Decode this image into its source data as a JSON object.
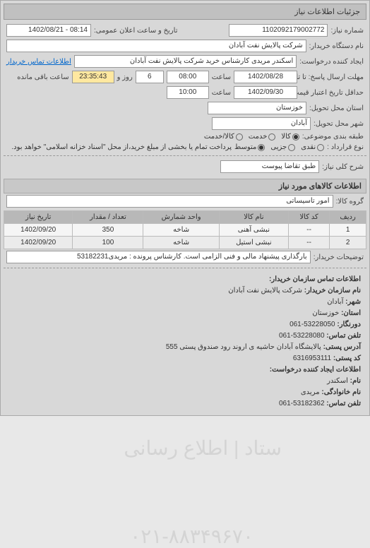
{
  "header": {
    "title": "جزئیات اطلاعات نیاز"
  },
  "fields": {
    "req_number_label": "شماره نیاز:",
    "req_number": "1102092179002772",
    "announce_label": "تاریخ و ساعت اعلان عمومی:",
    "announce": "08:14 - 1402/08/21",
    "buyer_org_label": "نام دستگاه خریدار:",
    "buyer_org": "شرکت پالایش نفت آبادان",
    "requester_label": "ایجاد کننده درخواست:",
    "requester": "اسکندر مریدی کارشناس خرید شرکت پالایش نفت آبادان",
    "buyer_contact_link": "اطلاعات تماس خریدار",
    "deadline_label": "مهلت ارسال پاسخ: تا تاریخ:",
    "deadline_date": "1402/08/28",
    "time_label": "ساعت",
    "deadline_time": "08:00",
    "remain_and": "و",
    "remain_days": "6",
    "remain_days_label": "روز و",
    "remain_time": "23:35:43",
    "remain_label": "ساعت باقی مانده",
    "validity_label": "حداقل تاریخ اعتبار قیمت: تا تاریخ:",
    "validity_date": "1402/09/30",
    "validity_time": "10:00",
    "province_label": "استان محل تحویل:",
    "province": "خوزستان",
    "city_label": "شهر محل تحویل:",
    "city": "آبادان",
    "subject_class_label": "طبقه بندی موضوعی:",
    "subject_kala": "کالا",
    "subject_service": "خدمت",
    "subject_both": "کالا/خدمت",
    "pay_type_label": "نوع قرارداد :",
    "pay_cash": "نقدی",
    "pay_partial": "جزیی",
    "pay_medium": "متوسط",
    "pay_note": "پرداخت تمام یا بخشی از مبلغ خرید،از محل \"اسناد خزانه اسلامی\" خواهد بود.",
    "general_desc_label": "شرح کلی نیاز:",
    "general_desc": "طبق تقاضا پیوست",
    "items_section": "اطلاعات کالاهای مورد نیاز",
    "group_label": "گروه کالا:",
    "group": "امور تاسیساتی",
    "buyer_notes_label": "توضیحات خریدار:",
    "buyer_notes": "بارگذاری پیشنهاد مالی و فنی الزامی است. کارشناس پرونده : مریدی53182231"
  },
  "table": {
    "headers": {
      "row": "ردیف",
      "code": "کد کالا",
      "name": "نام کالا",
      "unit": "واحد شمارش",
      "qty": "تعداد / مقدار",
      "date": "تاریخ نیاز"
    },
    "rows": [
      {
        "row": "1",
        "code": "--",
        "name": "نبشی آهنی",
        "unit": "شاخه",
        "qty": "350",
        "date": "1402/09/20"
      },
      {
        "row": "2",
        "code": "--",
        "name": "نبشی استیل",
        "unit": "شاخه",
        "qty": "100",
        "date": "1402/09/20"
      }
    ]
  },
  "contact": {
    "section": "اطلاعات تماس سازمان خریدار:",
    "org_label": "نام سازمان خریدار:",
    "org": "شرکت پالایش نفت آبادان",
    "city_label": "شهر:",
    "city": "آبادان",
    "province_label": "استان:",
    "province": "خوزستان",
    "fax_label": "دورنگار:",
    "fax": "53228050-061",
    "phone_label": "تلفن تماس:",
    "phone": "53228080-061",
    "address_label": "آدرس پستی:",
    "address": "پالایشگاه آبادان حاشیه ی اروند رود صندوق پستی 555",
    "postal_label": "کد پستی:",
    "postal": "6316953111",
    "req_creator_section": "اطلاعات ایجاد کننده درخواست:",
    "name_label": "نام:",
    "name": "اسکندر",
    "surname_label": "نام خانوادگی:",
    "surname": "مریدی",
    "phone2_label": "تلفن تماس:",
    "phone2": "53182362-061"
  },
  "watermark": {
    "line1": "ستاد | اطلاع رسانی",
    "line2": "۰۲۱-۸۸۳۴۹۶۷۰"
  }
}
